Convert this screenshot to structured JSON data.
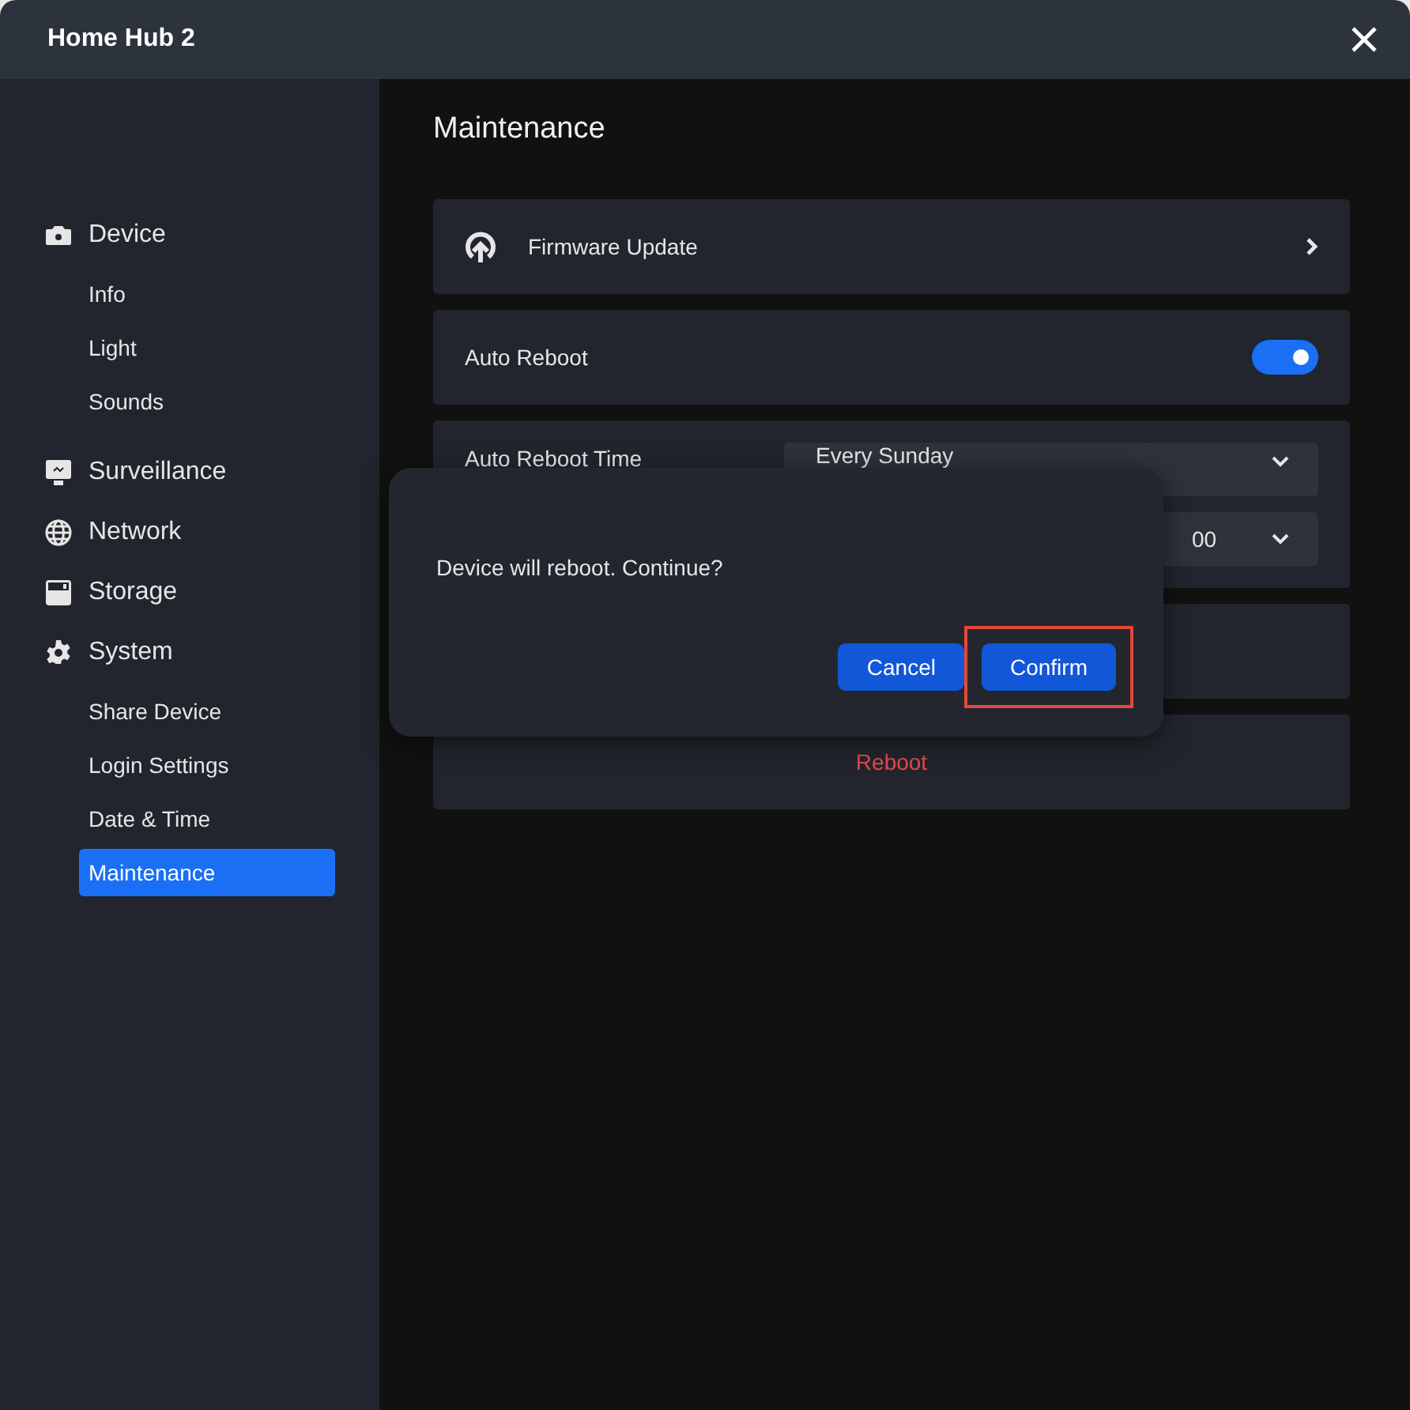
{
  "window": {
    "title": "Home Hub 2"
  },
  "sidebar": {
    "groups": [
      {
        "label": "Device",
        "items": [
          {
            "label": "Info",
            "selected": false
          },
          {
            "label": "Light",
            "selected": false
          },
          {
            "label": "Sounds",
            "selected": false
          }
        ]
      },
      {
        "label": "Surveillance"
      },
      {
        "label": "Network"
      },
      {
        "label": "Storage"
      },
      {
        "label": "System",
        "items": [
          {
            "label": "Share Device",
            "selected": false
          },
          {
            "label": "Login Settings",
            "selected": false
          },
          {
            "label": "Date & Time",
            "selected": false
          },
          {
            "label": "Maintenance",
            "selected": true
          }
        ]
      }
    ]
  },
  "content": {
    "heading": "Maintenance",
    "cards": [
      {
        "kind": "link",
        "label": "Firmware Update"
      },
      {
        "kind": "toggle",
        "label": "Auto Reboot",
        "on": true
      },
      {
        "kind": "schedule",
        "label": "Auto Reboot Time",
        "day_select": "Every Sunday",
        "minute_select": "00"
      },
      {
        "kind": "blank"
      },
      {
        "kind": "action",
        "label": "Reboot"
      }
    ]
  },
  "dialog": {
    "message": "Device will reboot. Continue?",
    "buttons": [
      {
        "label": "Cancel",
        "highlighted": false
      },
      {
        "label": "Confirm",
        "highlighted": true
      }
    ]
  }
}
